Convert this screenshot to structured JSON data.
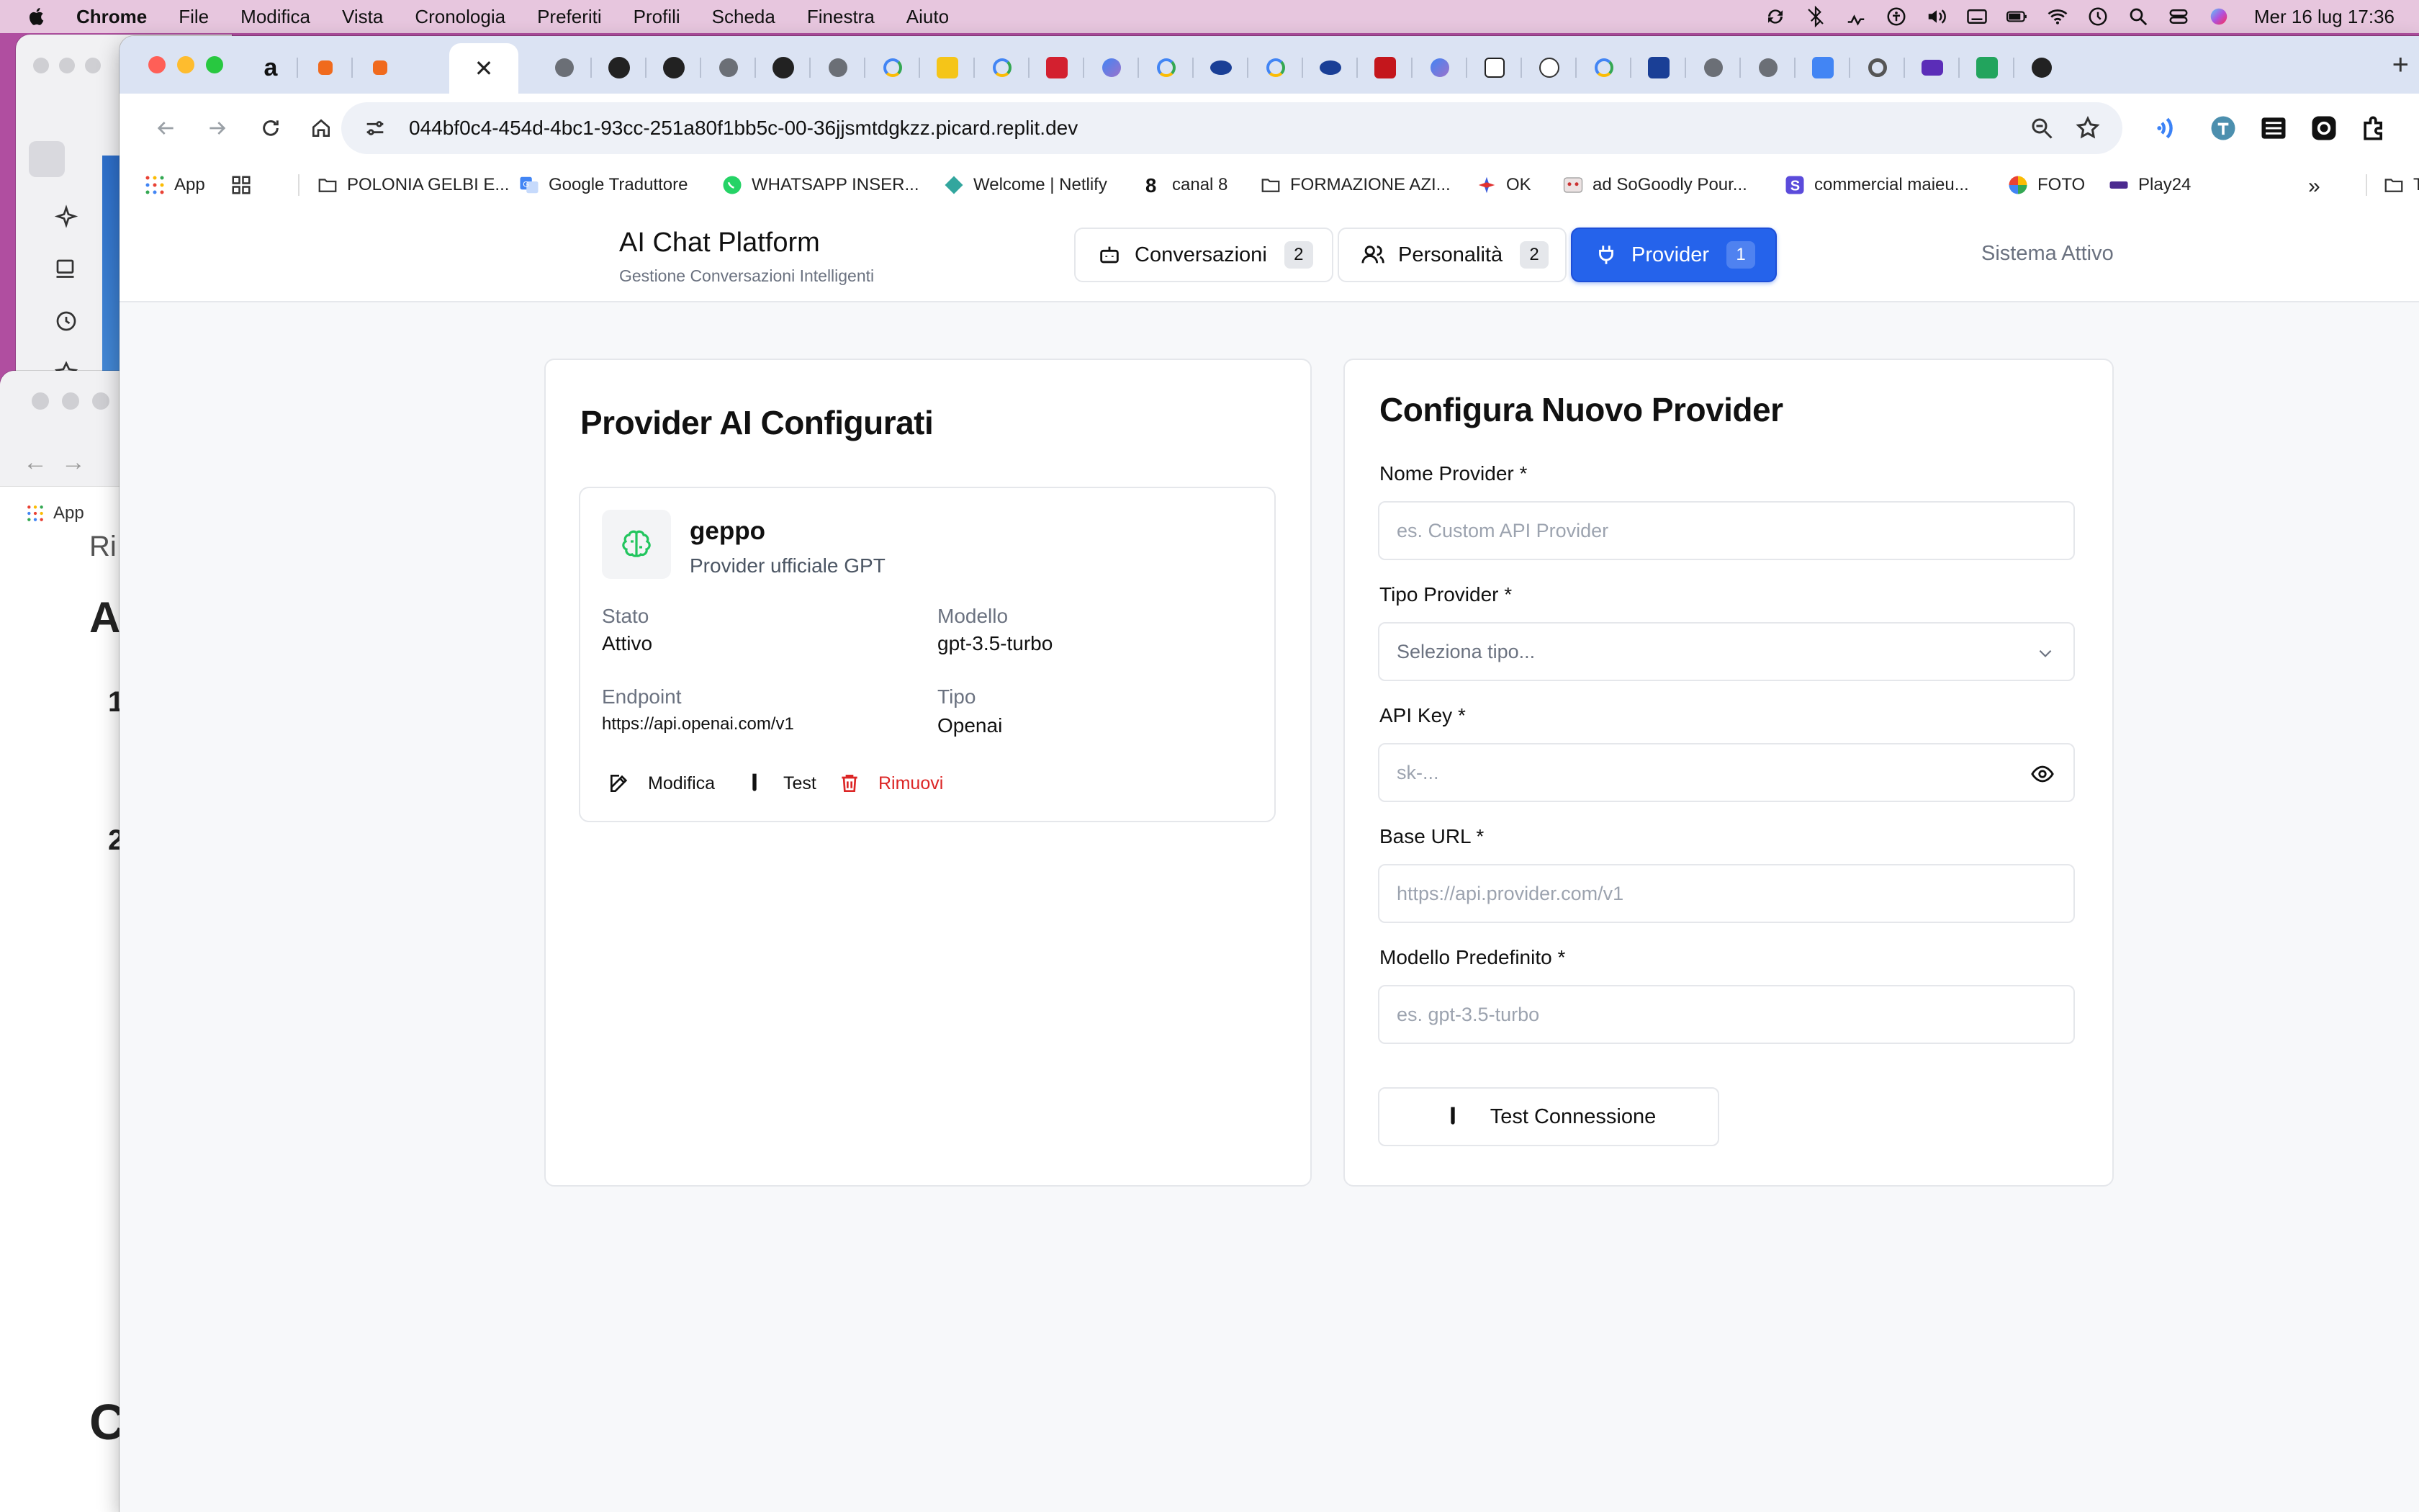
{
  "menubar": {
    "app_name": "Chrome",
    "items": [
      "File",
      "Modifica",
      "Vista",
      "Cronologia",
      "Preferiti",
      "Profili",
      "Scheda",
      "Finestra",
      "Aiuto"
    ],
    "clock": "Mer 16 lug  17:36"
  },
  "browser": {
    "url": "044bf0c4-454d-4bc1-93cc-251a80f1bb5c-00-36jjsmtdgkzz.picard.replit.dev",
    "new_tab": "+",
    "bookmarks_overflow": "»",
    "bookmarks": [
      {
        "label": "App",
        "icon": "apps-grid-icon"
      },
      {
        "label": "",
        "icon": "grid-icon"
      },
      {
        "label": "POLONIA GELBI E...",
        "icon": "folder-icon"
      },
      {
        "label": "Google Traduttore",
        "icon": "translate-icon"
      },
      {
        "label": "WHATSAPP INSER...",
        "icon": "whatsapp-icon"
      },
      {
        "label": "Welcome | Netlify",
        "icon": "netlify-icon"
      },
      {
        "label": "canal 8",
        "icon": "canal8-icon"
      },
      {
        "label": "FORMAZIONE AZI...",
        "icon": "folder-icon"
      },
      {
        "label": "OK",
        "icon": "ok-icon"
      },
      {
        "label": "ad SoGoodly Pour...",
        "icon": "sogoodly-icon"
      },
      {
        "label": "commercial maieu...",
        "icon": "s-icon"
      },
      {
        "label": "FOTO",
        "icon": "photos-icon"
      },
      {
        "label": "Play24",
        "icon": "play24-icon"
      },
      {
        "label": "Tu",
        "icon": "folder-icon"
      }
    ]
  },
  "background_window": {
    "apps_label": "App",
    "partial_chars": [
      "Ri",
      "A",
      "1",
      "2",
      "C"
    ]
  },
  "app": {
    "title": "AI Chat Platform",
    "subtitle": "Gestione Conversazioni Intelligenti",
    "status": "Sistema Attivo",
    "tabs": [
      {
        "label": "Conversazioni",
        "count": "2",
        "icon": "bot-icon",
        "active": false
      },
      {
        "label": "Personalità",
        "count": "2",
        "icon": "users-icon",
        "active": false
      },
      {
        "label": "Provider",
        "count": "1",
        "icon": "plug-icon",
        "active": true
      }
    ]
  },
  "providers_panel": {
    "title": "Provider AI Configurati",
    "items": [
      {
        "name": "geppo",
        "description": "Provider ufficiale GPT",
        "icon": "brain-icon",
        "fields": {
          "stato_label": "Stato",
          "stato": "Attivo",
          "modello_label": "Modello",
          "modello": "gpt-3.5-turbo",
          "endpoint_label": "Endpoint",
          "endpoint": "https://api.openai.com/v1",
          "tipo_label": "Tipo",
          "tipo": "Openai"
        },
        "actions": {
          "edit": "Modifica",
          "test": "Test",
          "remove": "Rimuovi"
        }
      }
    ]
  },
  "form": {
    "title": "Configura Nuovo Provider",
    "name_label": "Nome Provider *",
    "name_placeholder": "es. Custom API Provider",
    "type_label": "Tipo Provider *",
    "type_placeholder": "Seleziona tipo...",
    "apikey_label": "API Key *",
    "apikey_placeholder": "sk-...",
    "baseurl_label": "Base URL *",
    "baseurl_placeholder": "https://api.provider.com/v1",
    "model_label": "Modello Predefinito *",
    "model_placeholder": "es. gpt-3.5-turbo",
    "test_button": "Test Connessione"
  },
  "colors": {
    "accent": "#2563eb",
    "danger": "#dc2626",
    "brain_icon": "#22c55e",
    "desktop": "#b04ea0"
  }
}
